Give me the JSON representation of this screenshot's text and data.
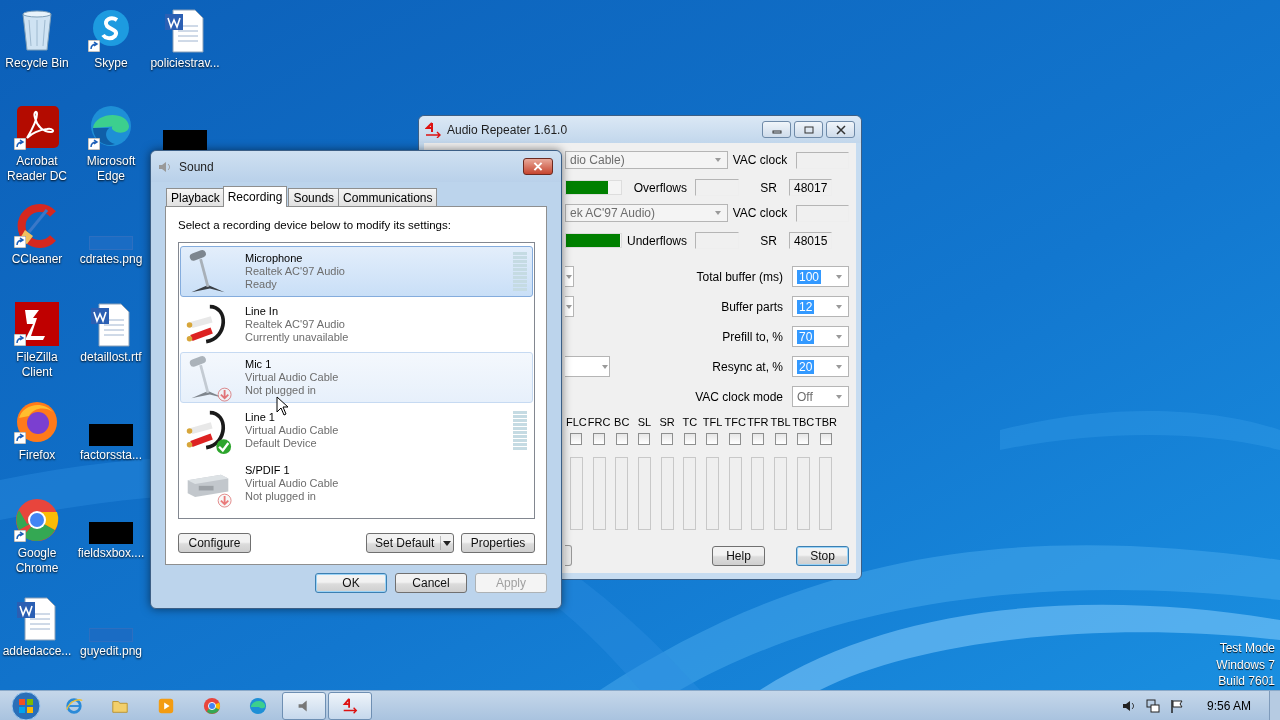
{
  "desktop": {
    "icons": [
      {
        "label": "Recycle Bin",
        "kind": "recycle",
        "shortcut": false
      },
      {
        "label": "Acrobat Reader DC",
        "kind": "acrobat",
        "shortcut": true
      },
      {
        "label": "CCleaner",
        "kind": "ccleaner",
        "shortcut": true
      },
      {
        "label": "FileZilla Client",
        "kind": "filezilla",
        "shortcut": true
      },
      {
        "label": "Firefox",
        "kind": "firefox",
        "shortcut": true
      },
      {
        "label": "Google Chrome",
        "kind": "chrome",
        "shortcut": true
      },
      {
        "label": "addedacce...",
        "kind": "word",
        "shortcut": false
      },
      {
        "label": "Skype",
        "kind": "skype",
        "shortcut": true
      },
      {
        "label": "Microsoft Edge",
        "kind": "edge",
        "shortcut": true
      },
      {
        "label": "cdrates.png",
        "kind": "blank-thumb",
        "shortcut": false
      },
      {
        "label": "detaillost.rtf",
        "kind": "word",
        "shortcut": false
      },
      {
        "label": "factorssta...",
        "kind": "black-thumb",
        "shortcut": false
      },
      {
        "label": "fieldsxbox....",
        "kind": "black-thumb",
        "shortcut": false
      },
      {
        "label": "guyedit.png",
        "kind": "blank-thumb",
        "shortcut": false
      },
      {
        "label": "policiestrav...",
        "kind": "word",
        "shortcut": false
      },
      {
        "kind": "black-thumb",
        "shortcut": false
      }
    ]
  },
  "audio_repeater": {
    "title": "Audio Repeater 1.61.0",
    "input": {
      "device": "dio Cable)",
      "vac_clock_label": "VAC clock",
      "level": 0.77,
      "flow_label": "Overflows",
      "sr_label": "SR",
      "sr": "48017"
    },
    "output": {
      "device": "ek AC'97 Audio)",
      "vac_clock_label": "VAC clock",
      "level": 0.98,
      "flow_label": "Underflows",
      "sr_label": "SR",
      "sr": "48015"
    },
    "settings": [
      {
        "label": "Total buffer (ms)",
        "value": "100",
        "highlighted": true
      },
      {
        "label": "Buffer parts",
        "value": "12",
        "highlighted": true
      },
      {
        "label": "Prefill to, %",
        "value": "70",
        "highlighted": true
      },
      {
        "label": "Resync at, %",
        "value": "20",
        "highlighted": true
      },
      {
        "label": "VAC clock mode",
        "value": "Off",
        "highlighted": false
      }
    ],
    "channels": [
      {
        "label": "FLC",
        "checked": false
      },
      {
        "label": "FRC",
        "checked": false
      },
      {
        "label": "BC",
        "checked": false
      },
      {
        "label": "SL",
        "checked": false
      },
      {
        "label": "SR",
        "checked": false
      },
      {
        "label": "TC",
        "checked": false
      },
      {
        "label": "TFL",
        "checked": false
      },
      {
        "label": "TFC",
        "checked": false
      },
      {
        "label": "TFR",
        "checked": false
      },
      {
        "label": "TBL",
        "checked": false
      },
      {
        "label": "TBC",
        "checked": false
      },
      {
        "label": "TBR",
        "checked": false
      }
    ],
    "buttons": [
      {
        "label": "Help",
        "default": false
      },
      {
        "label": "Stop",
        "default": true
      }
    ]
  },
  "sound": {
    "title": "Sound",
    "tabs": [
      {
        "label": "Playback",
        "selected": false
      },
      {
        "label": "Recording",
        "selected": true
      },
      {
        "label": "Sounds",
        "selected": false
      },
      {
        "label": "Communications",
        "selected": false
      }
    ],
    "instruction": "Select a recording device below to modify its settings:",
    "devices": [
      {
        "name": "Microphone",
        "driver": "Realtek AC'97 Audio",
        "status": "Ready",
        "kind": "microphone",
        "unplugged": false,
        "default": false,
        "meter": true,
        "selected": true,
        "hovered": false
      },
      {
        "name": "Line In",
        "driver": "Realtek AC'97 Audio",
        "status": "Currently unavailable",
        "kind": "cable",
        "unplugged": false,
        "default": false,
        "meter": false,
        "selected": false,
        "hovered": false
      },
      {
        "name": "Mic 1",
        "driver": "Virtual Audio Cable",
        "status": "Not plugged in",
        "kind": "microphone",
        "unplugged": true,
        "default": false,
        "meter": false,
        "selected": false,
        "hovered": true
      },
      {
        "name": "Line 1",
        "driver": "Virtual Audio Cable",
        "status": "Default Device",
        "kind": "cable",
        "unplugged": false,
        "default": true,
        "meter": true,
        "selected": false,
        "hovered": false
      },
      {
        "name": "S/PDIF 1",
        "driver": "Virtual Audio Cable",
        "status": "Not plugged in",
        "kind": "spdif",
        "unplugged": true,
        "default": false,
        "meter": false,
        "selected": false,
        "hovered": false
      }
    ],
    "device_buttons": [
      {
        "label": "Configure",
        "kind": "plain"
      },
      {
        "label": "Set Default",
        "kind": "split"
      },
      {
        "label": "Properties",
        "kind": "plain"
      }
    ],
    "buttons": [
      {
        "label": "OK",
        "default": true,
        "disabled": false
      },
      {
        "label": "Cancel",
        "default": false,
        "disabled": false
      },
      {
        "label": "Apply",
        "default": false,
        "disabled": true
      }
    ]
  },
  "os_notice": [
    "Test Mode",
    "Windows 7",
    "Build 7601"
  ],
  "taskbar": {
    "items": [
      {
        "kind": "ie",
        "active": false
      },
      {
        "kind": "explorer",
        "active": false
      },
      {
        "kind": "media",
        "active": false
      },
      {
        "kind": "chrome",
        "active": false
      },
      {
        "kind": "edge",
        "active": false
      },
      {
        "kind": "speaker",
        "active": true
      },
      {
        "kind": "repeater",
        "active": true
      }
    ],
    "clock": "9:56 AM"
  }
}
